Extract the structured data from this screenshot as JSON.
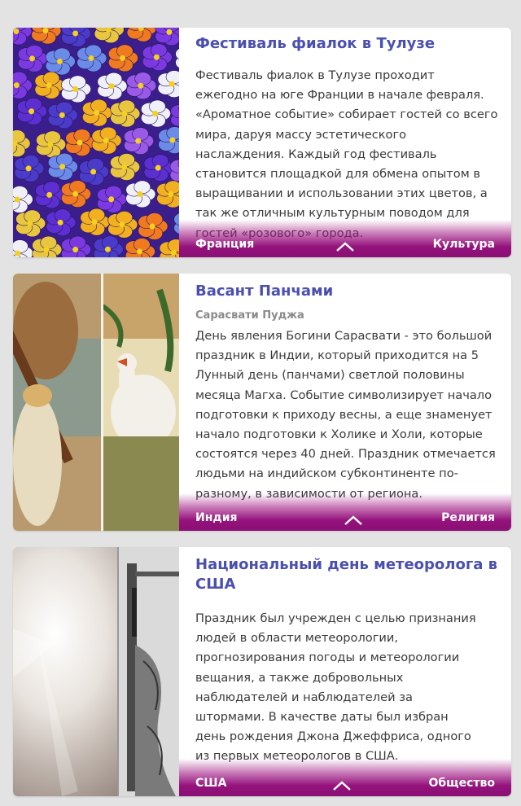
{
  "cards": [
    {
      "title": "Фестиваль фиалок в Тулузе",
      "subtitle": "",
      "text": "Фестиваль фиалок в Тулузе проходит ежегодно на юге Франции в начале февраля. «Ароматное событие» собирает гостей со всего мира, даруя массу эстетического наслаждения. Каждый год фестиваль становится площадкой для обмена опытом в выращивании и использовании этих цветов, а так же отличным культурным поводом для гостей «розового» города.",
      "country": "Франция",
      "category": "Культура",
      "image_icon": "violets-photo"
    },
    {
      "title": "Васант Панчами",
      "subtitle": "Сарасвати Пуджа",
      "text": "День явления Богини Сарасвати - это большой праздник в Индии, который приходится на 5 Лунный день (панчами) светлой половины месяца Магха. Событие символизирует начало подготовки к приходу весны, а еще знаменует начало подготовки к Холике и Холи, которые состоятся через 40 дней. Праздник отмечается людьми на индийском субконтиненте по-разному, в зависимости от региона.",
      "country": "Индия",
      "category": "Религия",
      "image_icon": "saraswati-painting"
    },
    {
      "title": "Национальный день метеоролога в США",
      "subtitle": "",
      "text": "Праздник был учрежден с целью признания людей в области метеорологии, прогнозирования погоды и метеорологии вещания, а также добровольных наблюдателей и наблюдателей за штормами. В качестве даты был избран день рождения Джона Джеффриса, одного из первых метеорологов в США.",
      "country": "США",
      "category": "Общество",
      "image_icon": "sky-engraving"
    }
  ],
  "colors": {
    "title": "#4a4fb0",
    "footer": "#8a0f74",
    "background": "#e3e3e3"
  }
}
